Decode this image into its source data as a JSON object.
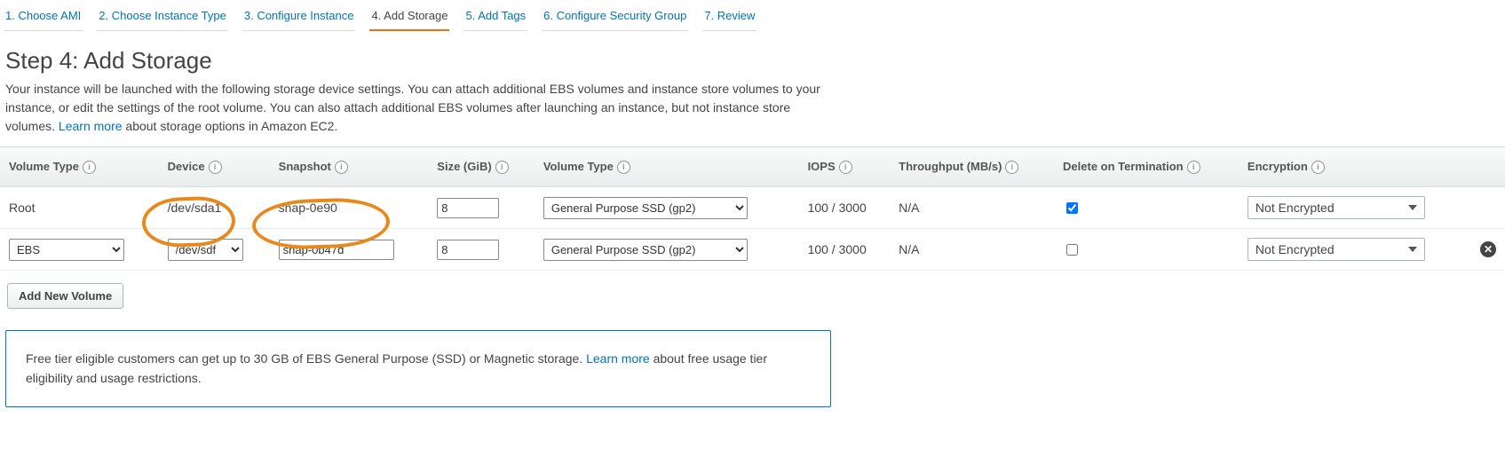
{
  "tabs": [
    {
      "label": "1. Choose AMI"
    },
    {
      "label": "2. Choose Instance Type"
    },
    {
      "label": "3. Configure Instance"
    },
    {
      "label": "4. Add Storage"
    },
    {
      "label": "5. Add Tags"
    },
    {
      "label": "6. Configure Security Group"
    },
    {
      "label": "7. Review"
    }
  ],
  "title": "Step 4: Add Storage",
  "desc_part1": "Your instance will be launched with the following storage device settings. You can attach additional EBS volumes and instance store volumes to your instance, or edit the settings of the root volume. You can also attach additional EBS volumes after launching an instance, but not instance store volumes. ",
  "desc_link": "Learn more",
  "desc_part2": " about storage options in Amazon EC2.",
  "headers": {
    "volume_type": "Volume Type",
    "device": "Device",
    "snapshot": "Snapshot",
    "size": "Size (GiB)",
    "volume_type2": "Volume Type",
    "iops": "IOPS",
    "throughput": "Throughput (MB/s)",
    "delete": "Delete on Termination",
    "encryption": "Encryption"
  },
  "rows": [
    {
      "label": "Root",
      "device": "/dev/sda1",
      "snapshot": "snap-0e90",
      "size": "8",
      "voltype": "General Purpose SSD (gp2)",
      "iops": "100 / 3000",
      "throughput": "N/A",
      "delete_checked": true,
      "encryption": "Not Encrypted"
    },
    {
      "label": "EBS",
      "device": "/dev/sdf",
      "snapshot": "snap-0b47d",
      "size": "8",
      "voltype": "General Purpose SSD (gp2)",
      "iops": "100 / 3000",
      "throughput": "N/A",
      "delete_checked": false,
      "encryption": "Not Encrypted"
    }
  ],
  "add_button": "Add New Volume",
  "notice_part1": "Free tier eligible customers can get up to 30 GB of EBS General Purpose (SSD) or Magnetic storage. ",
  "notice_link": "Learn more",
  "notice_part2": " about free usage tier eligibility and usage restrictions."
}
